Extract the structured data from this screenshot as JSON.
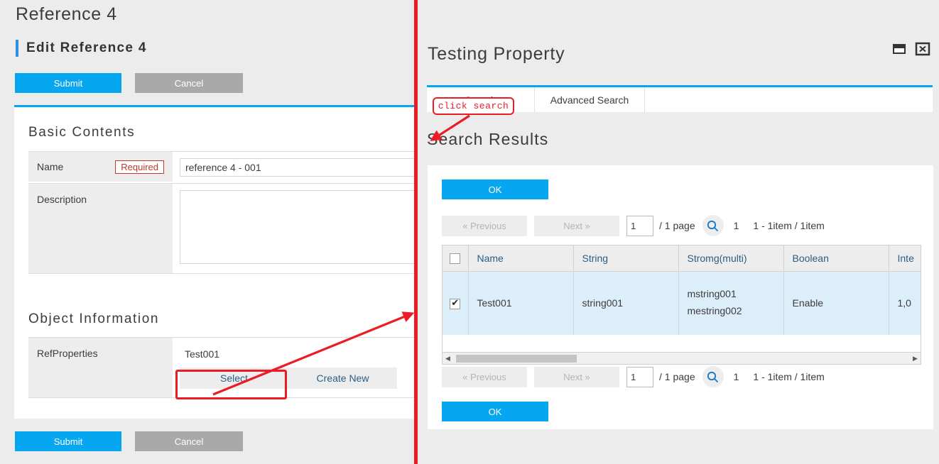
{
  "left": {
    "page_title": "Reference 4",
    "section_heading": "Edit Reference 4",
    "top_submit": "Submit",
    "top_cancel": "Cancel",
    "bottom_submit": "Submit",
    "bottom_cancel": "Cancel",
    "basic_contents_title": "Basic Contents",
    "object_information_title": "Object Information",
    "fields": {
      "name_label": "Name",
      "name_required_badge": "Required",
      "name_value": "reference 4 - 001",
      "description_label": "Description",
      "description_value": "",
      "refproperties_label": "RefProperties",
      "refproperties_value": "Test001",
      "select_button": "Select",
      "create_new_button": "Create New"
    }
  },
  "right": {
    "dialog_title": "Testing Property",
    "window_controls": {
      "restore": "restore-window-icon",
      "close": "close-window-icon"
    },
    "tabs": [
      {
        "label": "Search",
        "active": true
      },
      {
        "label": "Advanced Search",
        "active": false
      }
    ],
    "results_title": "Search Results",
    "ok_top": "OK",
    "ok_bottom": "OK",
    "pager": {
      "previous": "«  Previous",
      "next": "Next  »",
      "page_input_value": "1",
      "page_total_text": "/  1 page",
      "search_icon": "search-icon",
      "current_page": "1",
      "item_range": "1 - 1item / 1item"
    },
    "table": {
      "columns": [
        "Name",
        "String",
        "Stromg(multi)",
        "Boolean",
        "Inte"
      ],
      "rows": [
        {
          "checked": true,
          "name": "Test001",
          "string": "string001",
          "stromg_multi_1": "mstring001",
          "stromg_multi_2": "mestring002",
          "boolean": "Enable",
          "integer": "1,0"
        }
      ]
    }
  },
  "annotations": {
    "click_search_label": "click search",
    "select_highlight": "select-button-highlight",
    "divider_color": "#ec1c24"
  }
}
